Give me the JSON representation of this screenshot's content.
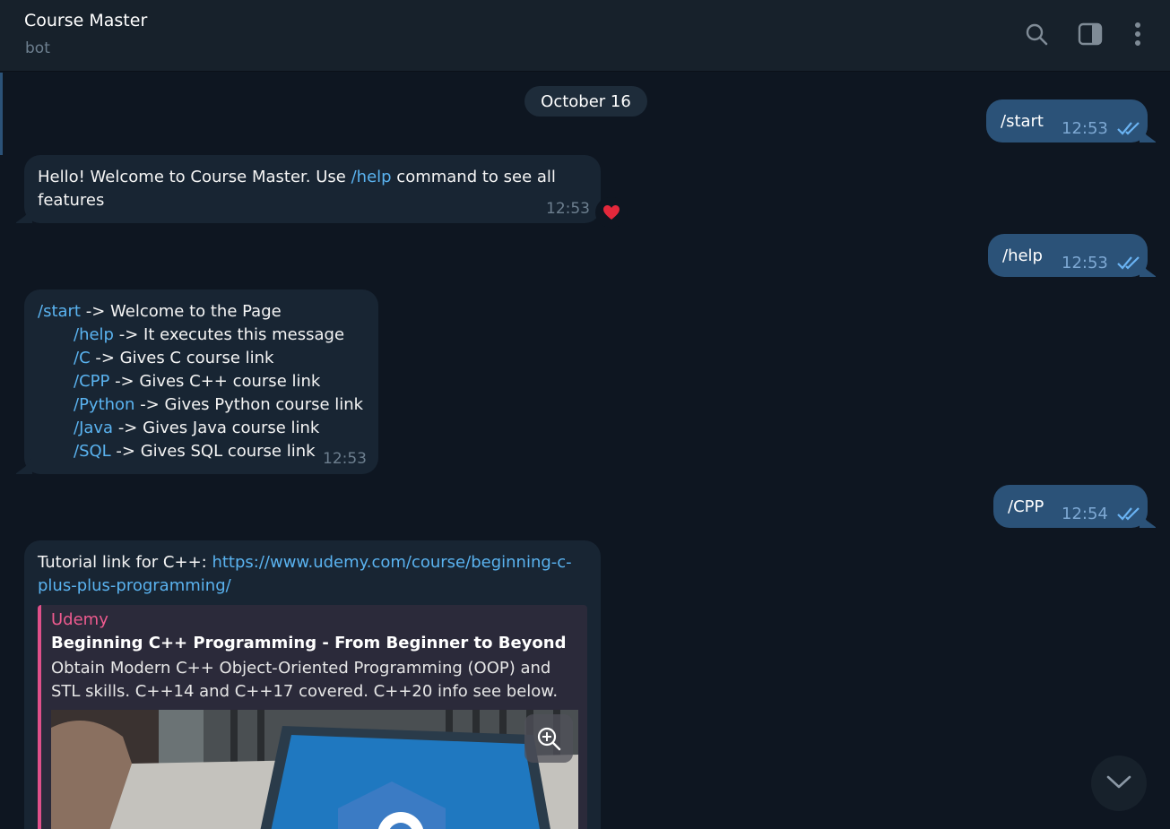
{
  "header": {
    "title": "Course Master",
    "subtitle": "bot"
  },
  "chat": {
    "date_divider": "October 16",
    "messages": {
      "start_cmd": {
        "text": "/start",
        "time": "12:53"
      },
      "welcome": {
        "before": "Hello! Welcome to Course Master. Use ",
        "cmd": "/help",
        "after": " command to see all",
        "line2": "features",
        "time": "12:53",
        "reaction": "heart"
      },
      "help_cmd": {
        "text": "/help",
        "time": "12:53"
      },
      "help_list": {
        "lines": [
          {
            "cmd": "/start",
            "desc": " -> Welcome to the Page"
          },
          {
            "cmd": "/help",
            "desc": " -> It executes this message"
          },
          {
            "cmd": "/C",
            "desc": " -> Gives C course link"
          },
          {
            "cmd": "/CPP",
            "desc": " -> Gives C++ course link"
          },
          {
            "cmd": "/Python",
            "desc": " -> Gives Python course link"
          },
          {
            "cmd": "/Java",
            "desc": " -> Gives Java course link"
          },
          {
            "cmd": "/SQL",
            "desc": " -> Gives SQL course link"
          }
        ],
        "time": "12:53"
      },
      "cpp_cmd": {
        "text": "/CPP",
        "time": "12:54"
      },
      "tutorial": {
        "prefix": "Tutorial link for C++: ",
        "url_line1": "https://www.udemy.com/course/beginning-c-",
        "url_line2": "plus-plus-programming/",
        "preview": {
          "site": "Udemy",
          "title": "Beginning C++ Programming - From Beginner to Beyond",
          "description": "Obtain Modern C++ Object-Oriented Programming (OOP) and STL skills. C++14 and C++17 covered.  C++20 info see below."
        }
      }
    }
  },
  "icons": {
    "header": [
      "search-icon",
      "sidebar-toggle-icon",
      "more-vertical-icon"
    ],
    "message_status": "double-check-icon",
    "reaction": "heart-icon",
    "preview": "zoom-in-icon",
    "scroll": "chevron-down-icon"
  },
  "colors": {
    "background": "#0e1621",
    "incoming": "#182533",
    "outgoing": "#2b5278",
    "link": "#5ab3f0",
    "preview_accent": "#e0508a"
  }
}
